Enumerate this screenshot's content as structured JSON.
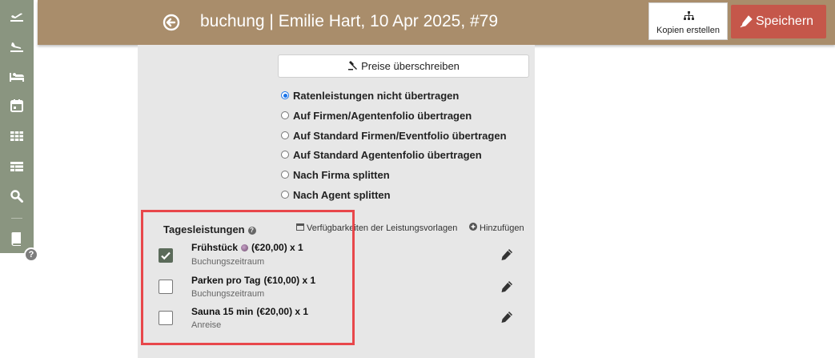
{
  "sidebar": {
    "icons": [
      "departure-icon",
      "arrival-icon",
      "bed-icon",
      "calendar-icon",
      "grid-icon",
      "table-icon",
      "search-icon",
      "book-icon"
    ],
    "help_label": "?"
  },
  "header": {
    "title": "buchung | Emilie Hart, 10 Apr 2025, #79",
    "copy_label": "Kopien erstellen",
    "save_label": "Speichern"
  },
  "main": {
    "override_label": "Preise überschreiben",
    "radio_options": [
      {
        "label": "Ratenleistungen nicht übertragen",
        "selected": true
      },
      {
        "label": "Auf Firmen/Agentenfolio übertragen",
        "selected": false
      },
      {
        "label": "Auf Standard Firmen/Eventfolio übertragen",
        "selected": false
      },
      {
        "label": "Auf Standard Agentenfolio übertragen",
        "selected": false
      },
      {
        "label": "Nach Firma splitten",
        "selected": false
      },
      {
        "label": "Nach Agent splitten",
        "selected": false
      }
    ],
    "daily_services": {
      "title": "Tagesleistungen",
      "availability_link": "Verfügbarkeiten der Leistungsvorlagen",
      "add_link": "Hinzufügen",
      "items": [
        {
          "name": "Frühstück",
          "price": "(€20,00) x 1",
          "sub": "Buchungszeitraum",
          "checked": true,
          "has_dot": true
        },
        {
          "name": "Parken pro Tag",
          "price": "(€10,00) x 1",
          "sub": "Buchungszeitraum",
          "checked": false,
          "has_dot": false
        },
        {
          "name": "Sauna 15 min",
          "price": "(€20,00) x 1",
          "sub": "Anreise",
          "checked": false,
          "has_dot": false
        }
      ]
    }
  },
  "colors": {
    "header_bg": "#a98d6b",
    "sidebar_bg": "#8a9580",
    "save_bg": "#c5574a",
    "highlight": "#e8474b",
    "panel_bg": "#e7e7e7"
  }
}
